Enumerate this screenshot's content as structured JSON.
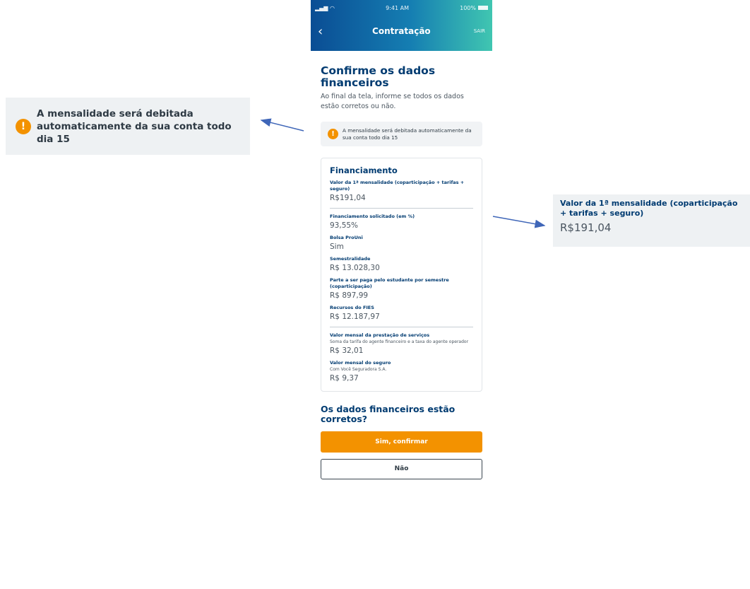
{
  "status_bar": {
    "time": "9:41 AM",
    "battery": "100%"
  },
  "nav": {
    "back_icon": "chevron-left-icon",
    "title": "Contratação",
    "exit_label": "SAIR"
  },
  "page": {
    "title": "Confirme os dados financeiros",
    "subtitle": "Ao final da tela, informe se todos os dados estão corretos ou não."
  },
  "notice": {
    "icon": "warning-icon",
    "text": "A mensalidade será debitada automaticamente da sua conta todo dia 15"
  },
  "card": {
    "title": "Financiamento",
    "first_installment": {
      "label": "Valor da 1ª mensalidade (coparticipação + tarifas + seguro)",
      "value": "R$191,04"
    },
    "requested_financing": {
      "label": "Financiamento solicitado (em %)",
      "value": "93,55%"
    },
    "prouni": {
      "label": "Bolsa ProUni",
      "value": "Sim"
    },
    "semester_fee": {
      "label": "Semestralidade",
      "value": "R$ 13.028,30"
    },
    "student_part": {
      "label": "Parte a ser paga pelo estudante por semestre (coparticipação)",
      "value": "R$ 897,99"
    },
    "fies_resources": {
      "label": "Recursos do FIES",
      "value": "R$ 12.187,97"
    },
    "service_fee": {
      "label": "Valor mensal da prestação de serviços",
      "note": "Soma da tarifa do agente financeiro e a taxa do agente operador",
      "value": "R$ 32,01"
    },
    "insurance": {
      "label": "Valor mensal do seguro",
      "note": "Com Você Seguradora S.A.",
      "value": "R$ 9,37"
    }
  },
  "confirm": {
    "question": "Os dados financeiros estão corretos?",
    "yes_label": "Sim, confirmar",
    "no_label": "Não"
  },
  "colors": {
    "primary_blue": "#003b71",
    "accent_orange": "#f39200",
    "header_gradient_start": "#0a4d94",
    "header_gradient_end": "#40c6b1"
  }
}
